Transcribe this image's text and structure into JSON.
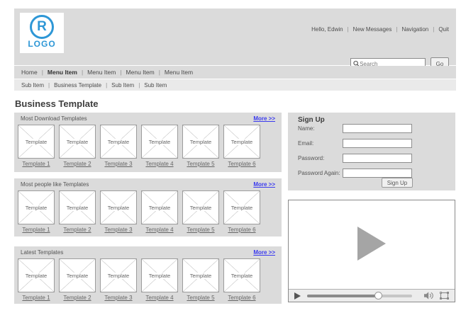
{
  "header": {
    "logo": {
      "letter": "R",
      "text": "LOGO"
    },
    "user_links": [
      "Hello, Edwin",
      "New Messages",
      "Navigation",
      "Quit"
    ],
    "search": {
      "placeholder": "Search",
      "go_label": "Go"
    }
  },
  "menu": {
    "items": [
      "Home",
      "Menu Item",
      "Menu Item",
      "Menu Item",
      "Menu Item"
    ],
    "active_index": 1
  },
  "submenu": {
    "items": [
      "Sub Item",
      "Business Template",
      "Sub Item",
      "Sub Item"
    ]
  },
  "page_title": "Business Template",
  "sections": [
    {
      "title": "Most Download Templates",
      "more_label": "More >>",
      "tiles": [
        {
          "label": "Template",
          "link": "Template 1"
        },
        {
          "label": "Template",
          "link": "Template 2"
        },
        {
          "label": "Template",
          "link": "Template 3"
        },
        {
          "label": "Template",
          "link": "Template 4"
        },
        {
          "label": "Template",
          "link": "Template 5"
        },
        {
          "label": "Template",
          "link": "Template 6"
        }
      ]
    },
    {
      "title": "Most people like Templates",
      "more_label": "More >>",
      "tiles": [
        {
          "label": "Template",
          "link": "Template 1"
        },
        {
          "label": "Template",
          "link": "Template 2"
        },
        {
          "label": "Template",
          "link": "Template 3"
        },
        {
          "label": "Template",
          "link": "Template 4"
        },
        {
          "label": "Template",
          "link": "Template 5"
        },
        {
          "label": "Template",
          "link": "Template 6"
        }
      ]
    },
    {
      "title": "Latest Templates",
      "more_label": "More >>",
      "tiles": [
        {
          "label": "Template",
          "link": "Template 1"
        },
        {
          "label": "Template",
          "link": "Template 2"
        },
        {
          "label": "Template",
          "link": "Template 3"
        },
        {
          "label": "Template",
          "link": "Template 4"
        },
        {
          "label": "Template",
          "link": "Template 5"
        },
        {
          "label": "Template",
          "link": "Template 6"
        }
      ]
    }
  ],
  "signup": {
    "title": "Sign Up",
    "fields": [
      {
        "label": "Name:",
        "value": ""
      },
      {
        "label": "Email:",
        "value": ""
      },
      {
        "label": "Password:",
        "value": ""
      },
      {
        "label": "Password Again:",
        "value": ""
      }
    ],
    "button_label": "Sign Up"
  },
  "video": {
    "progress_percent": 68,
    "icons": {
      "overlay": "play-triangle",
      "play": "play-triangle",
      "volume": "speaker-waves",
      "fullscreen": "corner-frame"
    }
  },
  "colors": {
    "panel_gray": "#dbdbdb",
    "submenu_gray": "#eaeaea",
    "link_blue": "#3a3aef",
    "logo_blue": "#2e97d6"
  }
}
